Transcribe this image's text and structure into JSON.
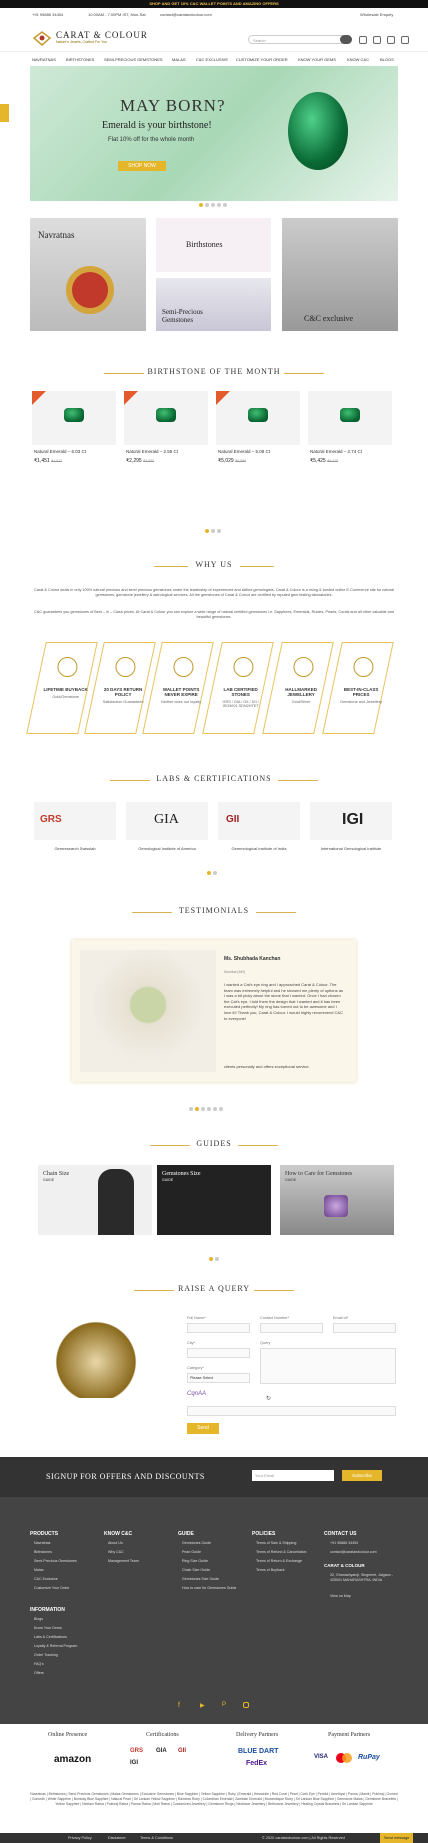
{
  "topbar": {
    "text": "SHOP AND GET 10% C&C WALLET POINTS AND AMAZING OFFERS"
  },
  "contact": {
    "phone": "+91 95886 34454",
    "hours": "10.00AM - 7.00PM IST, Mon-Sat",
    "email": "contact@caratandcolour.com",
    "wholesale": "Wholesale Enquiry"
  },
  "header": {
    "logo_name": "CARAT & COLOUR",
    "logo_tagline": "Nature's Jewels, Crafted For You",
    "search_placeholder": "Search"
  },
  "nav": [
    "NAVRATNAS",
    "BIRTHSTONES",
    "SEMI-PRECIOUS GEMSTONES",
    "MALAS",
    "C&C EXCLUSIVE",
    "CUSTOMIZE YOUR ORDER",
    "KNOW YOUR GEMS",
    "KNOW C&C",
    "BLOGS"
  ],
  "hero": {
    "title": "MAY BORN?",
    "subtitle": "Emerald is your birthstone!",
    "offer": "Flat 10% off for the whole month",
    "button": "SHOP NOW"
  },
  "categories": {
    "navratnas": "Navratnas",
    "birthstones": "Birthstones",
    "semi_precious": "Semi-Precious Gemstones",
    "exclusive": "C&C exclusive"
  },
  "sections": {
    "birthstone": "BIRTHSTONE OF THE MONTH",
    "why": "WHY US",
    "labs": "LABS & CERTIFICATIONS",
    "testimonials": "TESTIMONIALS",
    "guides": "GUIDES",
    "query": "RAISE A QUERY"
  },
  "products": [
    {
      "name": "Natural Emerald – 6.03 Ct",
      "price": "₹1,451",
      "old": "₹1,612",
      "tag": "10% OFF"
    },
    {
      "name": "Natural Emerald – 2.55 Ct",
      "price": "₹2,295",
      "old": "₹2,550",
      "tag": "10% OFF"
    },
    {
      "name": "Natural Emerald – 5.08 Ct",
      "price": "₹5,029",
      "old": "₹5,588",
      "tag": "10% OFF"
    },
    {
      "name": "Natural Emerald – 2.74 Ct",
      "price": "₹5,425",
      "old": "₹6,028",
      "tag": ""
    }
  ],
  "why": {
    "p1": "Carat & Colour deals in only 100% natural precious and semi precious gemstones under the leadership of experienced and skilled gemologists. Carat & Colour is a rising & trusted online E-Commerce site for natural gemstones, gemstone jewellery & astrological services. All the gemstones of Carat & Colour are certified by reputed gem testing laboratories.",
    "p2": "C&C guarantees you gemstones of Best – in – Class prices. At Carat & Colour you can explore a wide range of natural certified gemstones i.e. Sapphires, Emeralds, Rubies, Pearls, Corals and all other valuable and beautiful gemstones."
  },
  "features": [
    {
      "title": "LIFETIME BUYBACK",
      "sub": "Gold/Gemstone"
    },
    {
      "title": "20 DAYS RETURN POLICY",
      "sub": "Satisfaction Guaranteed"
    },
    {
      "title": "WALLET POINTS NEVER EXPIRE",
      "sub": "Neither does our loyalty"
    },
    {
      "title": "LAB CERTIFIED STONES",
      "sub": "GRS / GIA / GII / IGI / ISO9001 SDN2HTET"
    },
    {
      "title": "HALLMARKED JEWELLERY",
      "sub": "Gold/Silver"
    },
    {
      "title": "BEST-IN-CLASS PRICES",
      "sub": "Gemstone and Jewellery"
    }
  ],
  "labs": [
    {
      "logo": "GRS",
      "name": "Gemresearch Swisslab"
    },
    {
      "logo": "GIA",
      "name": "Gemological Institute of America"
    },
    {
      "logo": "GII",
      "name": "Gemmological Institute of India"
    },
    {
      "logo": "IGI",
      "name": "International Gemological Institute"
    }
  ],
  "testimonial": {
    "name": "Ms. Shubhada Kanchan",
    "city": "Mumbai (MH)",
    "text": "I wanted a Cat's eye ring and I approached Carat & Colour. The team was extremely helpful and he showed me plenty of options as I was a bit picky about the stone that I wanted. Once I had chosen the Cat's eye, I told them the design that I wanted and it has been executed perfectly! My ring has turned out to be awesome and I love it!! Thank you, Carat & Colour. I would highly recommend C&C to everyone!",
    "footer": "clients personally and offers exceptional service."
  },
  "guides": [
    {
      "title": "Chain Size",
      "sub": "GUIDE"
    },
    {
      "title": "Gemstones Size",
      "sub": "GUIDE"
    },
    {
      "title": "How to Care for Gemstones",
      "sub": "GUIDE"
    }
  ],
  "query": {
    "full_name": "Full Name*",
    "contact": "Contact Number*",
    "email": "Email Id*",
    "city": "City*",
    "query": "Query",
    "category": "Category*",
    "select": "Please Select",
    "send": "Send",
    "captcha": "CqnAA"
  },
  "signup": {
    "title": "SIGNUP FOR OFFERS AND DISCOUNTS",
    "placeholder": "Your Email",
    "button": "Subscribe"
  },
  "footer": {
    "products_title": "PRODUCTS",
    "products": [
      "Navratnas",
      "Birthstones",
      "Semi-Precious Gemstones",
      "Malas",
      "C&C Exclusive",
      "Customize Your Order"
    ],
    "know_title": "KNOW C&C",
    "know": [
      "About Us",
      "Why C&C",
      "Management Team"
    ],
    "guide_title": "GUIDE",
    "guide": [
      "Gemstones Guide",
      "Pearl Guide",
      "Ring Size Guide",
      "Chain Size Guide",
      "Gemstones Size Guide",
      "How to care for Gemstones Guide"
    ],
    "policies_title": "POLICIES",
    "policies": [
      "Terms of Sale & Shipping",
      "Terms of Refund & Cancellation",
      "Terms of Return & Exchange",
      "Terms of Buyback"
    ],
    "contact_title": "CONTACT US",
    "phone": "+91 95886 34454",
    "email": "contact@caratandcolour.com",
    "company": "CARAT & COLOUR",
    "address": "32, Ghanashyamji, Singmeet, Jalgaon - 425001 MAHARASHTRA, INDIA",
    "map": "View on Map",
    "info_title": "INFORMATION",
    "info": [
      "Blogs",
      "Know Your Gems",
      "Labs & Certifications",
      "Loyalty & Referral Program",
      "Order Tracking",
      "FAQ's",
      "Offers"
    ]
  },
  "partners": {
    "online": "Online Presence",
    "cert": "Certifications",
    "delivery": "Delivery Partners",
    "payment": "Payment Partners",
    "amazon": "amazon",
    "bluedart": "BLUE DART",
    "fedex": "FedEx",
    "rupay": "RuPay",
    "visa": "VISA"
  },
  "tags": "Navratnas | Birthstones | Semi-Precious Gemstones | Malas Gemstones | Exclusive Gemstones | Blue Sapphire | Yellow Sapphire | Ruby | Emerald | Hessonite | Red Coral | Pearl | Cat's Eye | Peridot | Amethyst | Panna | Manik | Pukhraj | Gomed | Gomedh | White Sapphire | Bombay Blue Sapphire | Natural Pearl | Sri Lankan Yellow Sapphire | Rainbow Ruby | Colombian Emerald | Zambian Emerald | Mozambique Ruby | Sri Lankan Blue Sapphire | Gemstone Malas | Gemstone Bracelets | Yellow Sapphire | Neelam Ratna | Pukhraj Ratna | Panna Ratna | Moti Ratna | Customized Jewellery | Gemstone Rings | Necklace Jewellery | Birthstone Jewellery | Healing Crystal Bracelets | Sri Lankan Sapphire",
  "bottom": {
    "privacy": "Privacy Policy",
    "disclaimer": "Disclaimer",
    "terms": "Terms & Conditions",
    "copy": "© 2020 caratandcolour.com | All Rights Reserved",
    "chat": "Send message"
  },
  "colors": {
    "gold": "#e5b62a",
    "dark": "#444444",
    "accent": "#d9b44a"
  }
}
